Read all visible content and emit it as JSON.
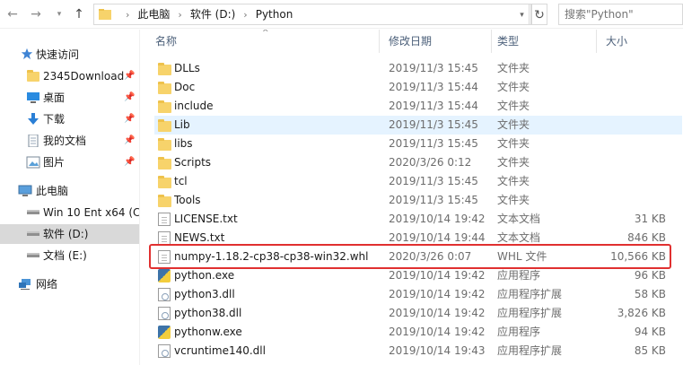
{
  "address": {
    "crumbs": [
      "此电脑",
      "软件 (D:)",
      "Python"
    ],
    "search_placeholder": "搜索\"Python\""
  },
  "nav": {
    "quick_access": "快速访问",
    "items": [
      {
        "label": "2345Download",
        "icon": "folder-icon",
        "pinned": true
      },
      {
        "label": "桌面",
        "icon": "desktop-icon",
        "pinned": true
      },
      {
        "label": "下载",
        "icon": "download-icon",
        "pinned": true
      },
      {
        "label": "我的文档",
        "icon": "documents-icon",
        "pinned": true
      },
      {
        "label": "图片",
        "icon": "pictures-icon",
        "pinned": true
      }
    ],
    "this_pc": "此电脑",
    "drives": [
      {
        "label": "Win 10 Ent x64 (C"
      },
      {
        "label": "软件 (D:)",
        "selected": true
      },
      {
        "label": "文档 (E:)"
      }
    ],
    "network": "网络"
  },
  "columns": {
    "name": "名称",
    "date": "修改日期",
    "type": "类型",
    "size": "大小"
  },
  "files": [
    {
      "name": "DLLs",
      "date": "2019/11/3 15:45",
      "type": "文件夹",
      "size": "",
      "icon": "folder-icon"
    },
    {
      "name": "Doc",
      "date": "2019/11/3 15:44",
      "type": "文件夹",
      "size": "",
      "icon": "folder-icon"
    },
    {
      "name": "include",
      "date": "2019/11/3 15:44",
      "type": "文件夹",
      "size": "",
      "icon": "folder-icon"
    },
    {
      "name": "Lib",
      "date": "2019/11/3 15:45",
      "type": "文件夹",
      "size": "",
      "icon": "folder-icon",
      "hover": true
    },
    {
      "name": "libs",
      "date": "2019/11/3 15:45",
      "type": "文件夹",
      "size": "",
      "icon": "folder-icon"
    },
    {
      "name": "Scripts",
      "date": "2020/3/26 0:12",
      "type": "文件夹",
      "size": "",
      "icon": "folder-icon"
    },
    {
      "name": "tcl",
      "date": "2019/11/3 15:45",
      "type": "文件夹",
      "size": "",
      "icon": "folder-icon"
    },
    {
      "name": "Tools",
      "date": "2019/11/3 15:45",
      "type": "文件夹",
      "size": "",
      "icon": "folder-icon"
    },
    {
      "name": "LICENSE.txt",
      "date": "2019/10/14 19:42",
      "type": "文本文档",
      "size": "31 KB",
      "icon": "text-file-icon"
    },
    {
      "name": "NEWS.txt",
      "date": "2019/10/14 19:44",
      "type": "文本文档",
      "size": "846 KB",
      "icon": "text-file-icon"
    },
    {
      "name": "numpy-1.18.2-cp38-cp38-win32.whl",
      "date": "2020/3/26 0:07",
      "type": "WHL 文件",
      "size": "10,566 KB",
      "icon": "file-icon",
      "highlighted": true
    },
    {
      "name": "python.exe",
      "date": "2019/10/14 19:42",
      "type": "应用程序",
      "size": "96 KB",
      "icon": "python-icon"
    },
    {
      "name": "python3.dll",
      "date": "2019/10/14 19:42",
      "type": "应用程序扩展",
      "size": "58 KB",
      "icon": "dll-icon"
    },
    {
      "name": "python38.dll",
      "date": "2019/10/14 19:42",
      "type": "应用程序扩展",
      "size": "3,826 KB",
      "icon": "dll-icon"
    },
    {
      "name": "pythonw.exe",
      "date": "2019/10/14 19:42",
      "type": "应用程序",
      "size": "94 KB",
      "icon": "python-icon"
    },
    {
      "name": "vcruntime140.dll",
      "date": "2019/10/14 19:43",
      "type": "应用程序扩展",
      "size": "85 KB",
      "icon": "dll-icon"
    }
  ],
  "colors": {
    "selection": "#d9d9d9",
    "hover": "#e5f3ff",
    "highlight_box": "#e03030",
    "header_text": "#4c607a"
  }
}
